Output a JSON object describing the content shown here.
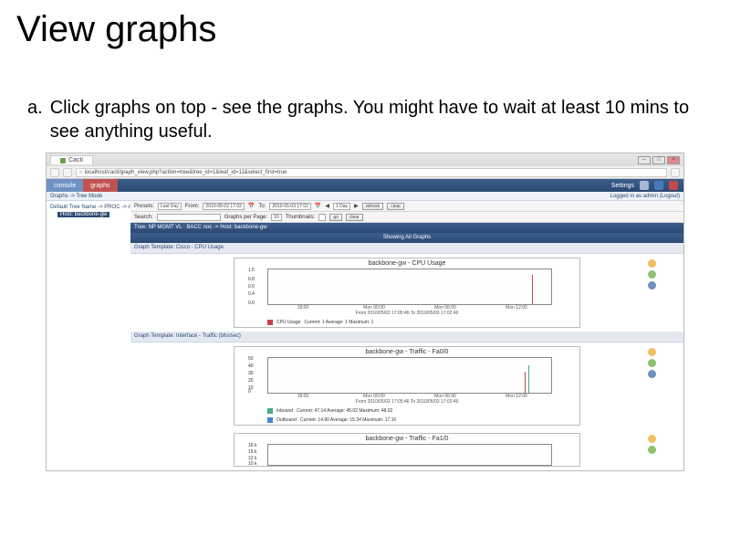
{
  "slide": {
    "title": "View graphs",
    "instruction_letter": "a.",
    "instruction_text": "Click graphs on top - see the graphs. You might have to wait at least 10 mins to see anything useful."
  },
  "browser": {
    "tab_title": "Cacti",
    "url": "localhost/cacti/graph_view.php?action=tree&tree_id=1&leaf_id=11&select_first=true"
  },
  "app": {
    "tab_console": "console",
    "tab_graphs": "graphs",
    "settings_label": "Settings",
    "login_text": "Logged in as admin (Logout)",
    "breadcrumb": "Graphs -> Tree Mode",
    "tree_root": "Default Tree Name -> PROC -> noc-m",
    "tree_child": "Host: backbone-gw"
  },
  "filters": {
    "presets_label": "Presets:",
    "presets_value": "Last Day",
    "from_label": "From:",
    "from_value": "2010-05-02 17:02",
    "to_label": "To:",
    "to_value": "2010-05-03 17:02",
    "shift_value": "1 Day",
    "refresh_btn": "refresh",
    "clear_btn": "clear",
    "search_label": "Search:",
    "gpp_label": "Graphs per Page:",
    "gpp_value": "10",
    "thumbnails_label": "Thumbnails:",
    "go_btn": "go",
    "clear2_btn": "clear"
  },
  "bars": {
    "tree_header": "Tree: NP MGMT VL : BACC  noc ->  Host: backbone-gw",
    "template1": "Graph Template: Cisco - CPU Usage",
    "template2": "Graph Template: Interface - Traffic (bits/sec)",
    "showing": "Showing All Graphs"
  },
  "chart_data": [
    {
      "type": "line",
      "title": "backbone-gw - CPU Usage",
      "ylim": [
        0,
        1.5
      ],
      "y_ticks": [
        "1.5",
        "0.8",
        "0.5",
        "0.4",
        "0.0"
      ],
      "x_ticks": [
        "18:00",
        "Mon 00:00",
        "Mon 06:00",
        "Mon 12:00"
      ],
      "caption": "From 2010/05/02 17:05:46 To 2010/05/03 17:02:46",
      "series": [
        {
          "name": "CPU Usage",
          "color": "#c44",
          "summary": "Current: 1  Average: 1  Maximum: 1"
        }
      ]
    },
    {
      "type": "line",
      "title": "backbone-gw - Traffic - Fa0/0",
      "ylim": [
        0,
        50
      ],
      "y_ticks": [
        "50",
        "40",
        "30",
        "20",
        "10",
        "0"
      ],
      "x_ticks": [
        "18:00",
        "Mon 00:00",
        "Mon 06:00",
        "Mon 12:00"
      ],
      "caption": "From 2010/05/02 17:05:46 To 2010/05/03 17:02:46",
      "series": [
        {
          "name": "Inbound",
          "color": "#4a8",
          "summary": "Current: 47.14  Average: 45.02  Maximum: 48.02"
        },
        {
          "name": "Outbound",
          "color": "#48c",
          "summary": "Current: 14.90  Average: 15.34  Maximum: 17.16"
        }
      ]
    },
    {
      "type": "line",
      "title": "backbone-gw - Traffic - Fa1/0",
      "ylim": [
        0,
        18
      ],
      "y_ticks": [
        "18 k",
        "15 k",
        "12 k",
        "10 k"
      ],
      "x_ticks": [],
      "caption": "",
      "series": []
    }
  ]
}
